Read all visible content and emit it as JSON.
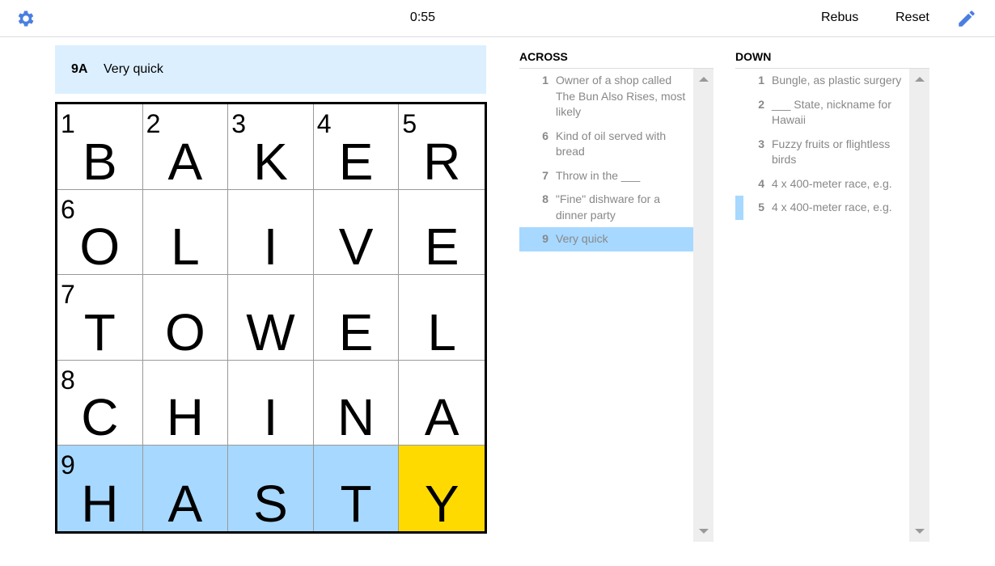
{
  "header": {
    "timer": "0:55",
    "rebus_label": "Rebus",
    "reset_label": "Reset",
    "accent_color": "#4a7fe0"
  },
  "current_clue": {
    "label": "9A",
    "text": "Very quick"
  },
  "grid": {
    "rows": [
      [
        {
          "n": "1",
          "l": "B"
        },
        {
          "n": "2",
          "l": "A"
        },
        {
          "n": "3",
          "l": "K"
        },
        {
          "n": "4",
          "l": "E"
        },
        {
          "n": "5",
          "l": "R"
        }
      ],
      [
        {
          "n": "6",
          "l": "O"
        },
        {
          "n": "",
          "l": "L"
        },
        {
          "n": "",
          "l": "I"
        },
        {
          "n": "",
          "l": "V"
        },
        {
          "n": "",
          "l": "E"
        }
      ],
      [
        {
          "n": "7",
          "l": "T"
        },
        {
          "n": "",
          "l": "O"
        },
        {
          "n": "",
          "l": "W"
        },
        {
          "n": "",
          "l": "E"
        },
        {
          "n": "",
          "l": "L"
        }
      ],
      [
        {
          "n": "8",
          "l": "C"
        },
        {
          "n": "",
          "l": "H"
        },
        {
          "n": "",
          "l": "I"
        },
        {
          "n": "",
          "l": "N"
        },
        {
          "n": "",
          "l": "A"
        }
      ],
      [
        {
          "n": "9",
          "l": "H"
        },
        {
          "n": "",
          "l": "A"
        },
        {
          "n": "",
          "l": "S"
        },
        {
          "n": "",
          "l": "T"
        },
        {
          "n": "",
          "l": "Y"
        }
      ]
    ],
    "highlight_color": "#a7d8ff",
    "cursor_color": "#ffda00"
  },
  "across": {
    "title": "ACROSS",
    "clues": [
      {
        "num": "1",
        "text": "Owner of a shop called The Bun Also Rises, most likely"
      },
      {
        "num": "6",
        "text": "Kind of oil served with bread"
      },
      {
        "num": "7",
        "text": "Throw in the ___"
      },
      {
        "num": "8",
        "text": "\"Fine\" dishware for a dinner party"
      },
      {
        "num": "9",
        "text": "Very quick"
      }
    ]
  },
  "down": {
    "title": "DOWN",
    "clues": [
      {
        "num": "1",
        "text": "Bungle, as plastic surgery"
      },
      {
        "num": "2",
        "text": "___ State, nickname for Hawaii"
      },
      {
        "num": "3",
        "text": "Fuzzy fruits or flightless birds"
      },
      {
        "num": "4",
        "text": "4 x 400-meter race, e.g."
      },
      {
        "num": "5",
        "text": "4 x 400-meter race, e.g."
      }
    ]
  }
}
